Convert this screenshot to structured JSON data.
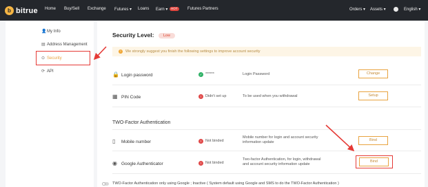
{
  "header": {
    "logo_mark": "b",
    "logo_text": "bitrue",
    "nav": [
      "Home",
      "Buy/Sell",
      "Exchange",
      "Futures ▾",
      "Loans",
      "Earn ▾",
      "Futures Partners"
    ],
    "hot_badge": "HOT",
    "right": [
      "Orders ▾",
      "Assets ▾",
      "English ▾"
    ]
  },
  "sidebar": {
    "items": [
      {
        "icon": "👤",
        "label": "My Info"
      },
      {
        "icon": "▤",
        "label": "Address Management"
      },
      {
        "icon": "⊙",
        "label": "Security"
      },
      {
        "icon": "⟳",
        "label": "API"
      }
    ]
  },
  "main": {
    "security_level_label": "Security Level:",
    "security_level_value": "Low",
    "warning_icon": "!",
    "warning_text": "We strongly suggest you finish the following settings to improve account security",
    "rows": [
      {
        "icon": "🔒",
        "label": "Login password",
        "status_icon": "✓",
        "status": "******",
        "description": "Login Password",
        "button": "Change"
      },
      {
        "icon": "▦",
        "label": "PIN Code",
        "status_icon": "!",
        "status": "Didn't set up",
        "description": "To be used when you withdrawal",
        "button": "Setup"
      }
    ],
    "tfa_title": "TWO-Factor Authentication",
    "tfa_rows": [
      {
        "icon": "▯",
        "label": "Mobile number",
        "status_icon": "!",
        "status": "Not binded",
        "description": [
          "Mobile number for login and account security",
          "information update"
        ],
        "button": "Bind"
      },
      {
        "icon": "◉",
        "label": "Google Authenticator",
        "status_icon": "!",
        "status": "Not binded",
        "description": [
          "Two-factor Authentication, for login, withdrawal",
          "and account security information update"
        ],
        "button": "Bind"
      }
    ],
    "footer_note": "TWO-Factor Authentication only using Google ; Inactive ( System default using Google and SMS to do the TWO-Factor Authentication )"
  },
  "colors": {
    "accent": "#e8a23e",
    "annotation": "#e53935",
    "topbar": "#24272c"
  }
}
